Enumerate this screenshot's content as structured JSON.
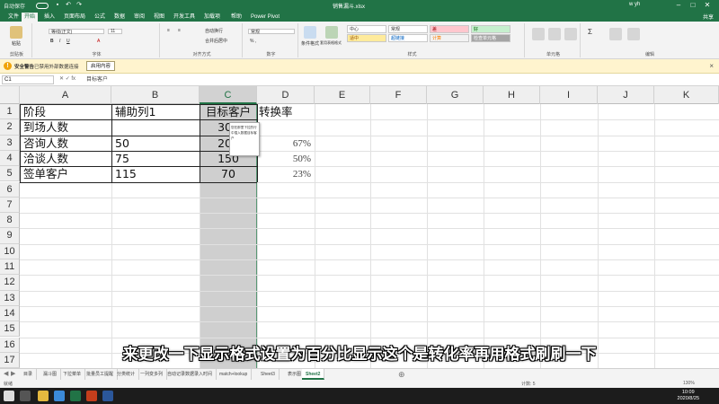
{
  "titlebar": {
    "autosave_label": "自动保存",
    "doc_title": "销售漏斗.xlsx",
    "user": "w yh"
  },
  "tabs": [
    "文件",
    "开始",
    "插入",
    "页面布局",
    "公式",
    "数据",
    "审阅",
    "视图",
    "开发工具",
    "加载项",
    "帮助",
    "Power Pivot"
  ],
  "active_tab": "开始",
  "share_label": "共享",
  "ribbon": {
    "paste_label": "粘贴",
    "clipboard_group": "剪贴板",
    "font_name": "等线(正文)",
    "font_size": "11",
    "font_group": "字体",
    "align_group": "对齐方式",
    "wrap_label": "自动换行",
    "merge_label": "合并后居中",
    "number_format": "常规",
    "number_group": "数字",
    "cond_format_label": "条件格式",
    "table_format_label": "套用表格格式",
    "styles": [
      {
        "label": "中心",
        "bg": "#ffffff",
        "fg": "#333333"
      },
      {
        "label": "常规",
        "bg": "#ffffff",
        "fg": "#333333"
      },
      {
        "label": "差",
        "bg": "#ffc7ce",
        "fg": "#9c0006"
      },
      {
        "label": "好",
        "bg": "#c6efce",
        "fg": "#006100"
      },
      {
        "label": "适中",
        "bg": "#ffeb9c",
        "fg": "#9c5700"
      },
      {
        "label": "超链接",
        "bg": "#ffffff",
        "fg": "#0563c1"
      },
      {
        "label": "计算",
        "bg": "#f2f2f2",
        "fg": "#fa7d00"
      },
      {
        "label": "检查单元格",
        "bg": "#a5a5a5",
        "fg": "#ffffff"
      }
    ],
    "styles_group": "样式",
    "cells_group": "单元格",
    "edit_group": "编辑"
  },
  "security_bar": {
    "title": "安全警告",
    "message": "已禁用外部数据连接",
    "enable_button": "启用内容"
  },
  "formula_bar": {
    "name_box": "C1",
    "formula": "目标客户"
  },
  "columns": [
    "A",
    "B",
    "C",
    "D",
    "E",
    "F",
    "G",
    "H",
    "I",
    "J",
    "K"
  ],
  "rows": [
    "1",
    "2",
    "3",
    "4",
    "5",
    "6",
    "7",
    "8",
    "9",
    "10",
    "11",
    "12",
    "13",
    "14",
    "15",
    "16",
    "17"
  ],
  "cells": {
    "A1": "阶段",
    "B1": "辅助列1",
    "C1": "目标客户",
    "D1": "转换率",
    "A2": "到场人数",
    "B2": "",
    "C2": "300",
    "A3": "咨询人数",
    "B3": "50",
    "C3": "200",
    "D3": "67%",
    "A4": "洽谈人数",
    "B4": "75",
    "C4": "150",
    "D4": "50%",
    "A5": "签单客户",
    "B5": "115",
    "C5": "70",
    "D5": "23%"
  },
  "tooltip": "您在那里下拉的行中插入数据目标客户",
  "subtitle": "来更改一下显示格式设置为百分比显示这个是转化率再用格式刷刷一下",
  "sheet_tabs": [
    "目录",
    "漏斗图",
    "下拉菜单",
    "批量员工提醒",
    "分类统计",
    "一列变多列",
    "自动记录数据录入时间",
    "match+lookup",
    "Sheet3",
    "表示图",
    "Sheet2"
  ],
  "active_sheet": "Sheet2",
  "status": {
    "ready": "就绪",
    "count": "计数: 5",
    "zoom": "130%"
  },
  "taskbar": {
    "time": "10:09",
    "date": "2020/8/25"
  }
}
